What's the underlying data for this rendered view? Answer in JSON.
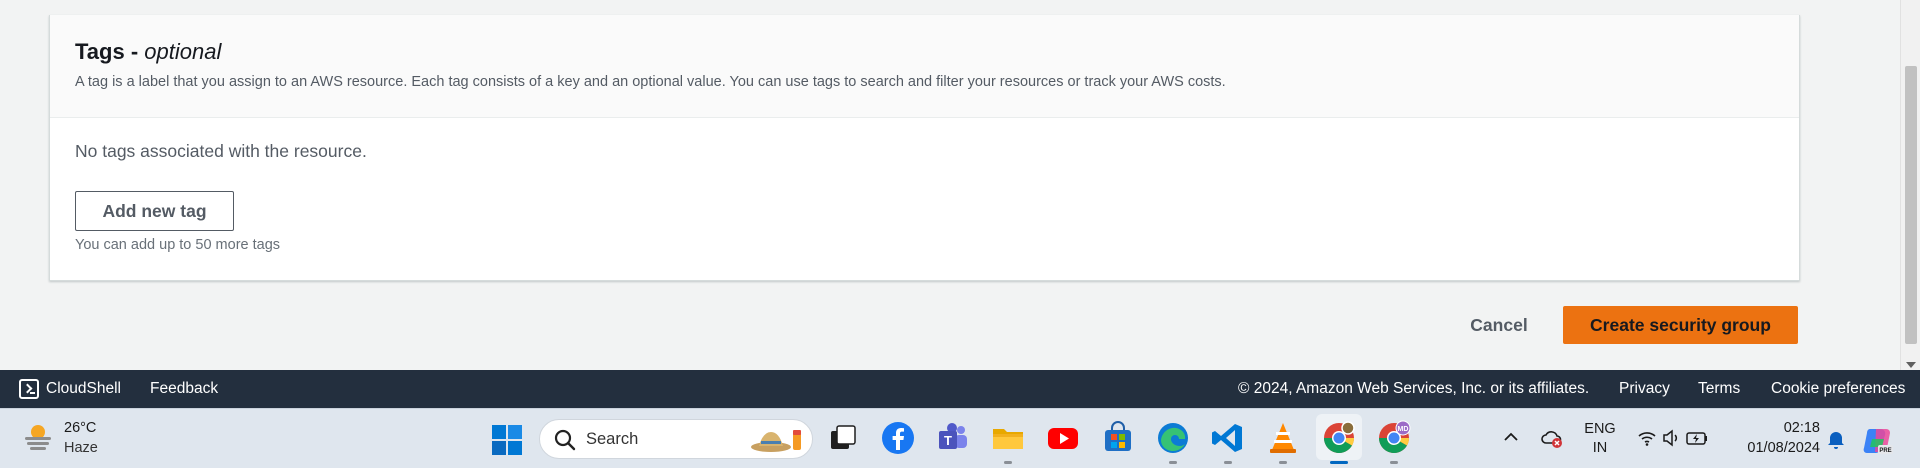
{
  "tags_panel": {
    "title": "Tags - ",
    "title_optional": "optional",
    "description": "A tag is a label that you assign to an AWS resource. Each tag consists of a key and an optional value. You can use tags to search and filter your resources or track your AWS costs.",
    "empty_text": "No tags associated with the resource.",
    "add_button": "Add new tag",
    "hint": "You can add up to 50 more tags"
  },
  "actions": {
    "cancel": "Cancel",
    "create": "Create security group"
  },
  "aws_footer": {
    "cloudshell": "CloudShell",
    "feedback": "Feedback",
    "copyright": "© 2024, Amazon Web Services, Inc. or its affiliates.",
    "privacy": "Privacy",
    "terms": "Terms",
    "cookie_preferences": "Cookie preferences"
  },
  "taskbar": {
    "weather_temp": "26°C",
    "weather_condition": "Haze",
    "search_placeholder": "Search",
    "apps": [
      "task-view",
      "facebook",
      "teams",
      "file-explorer",
      "youtube",
      "microsoft-store",
      "edge",
      "vscode",
      "vlc",
      "chrome",
      "chrome-profile"
    ],
    "chrome_profile_badge": "MD",
    "language_line1": "ENG",
    "language_line2": "IN",
    "time": "02:18",
    "date": "01/08/2024",
    "copilot_badge": "PRE"
  },
  "colors": {
    "primary_button": "#ec7211",
    "footer_bg": "#232f3e",
    "taskbar_bg": "#dfe6ee"
  }
}
